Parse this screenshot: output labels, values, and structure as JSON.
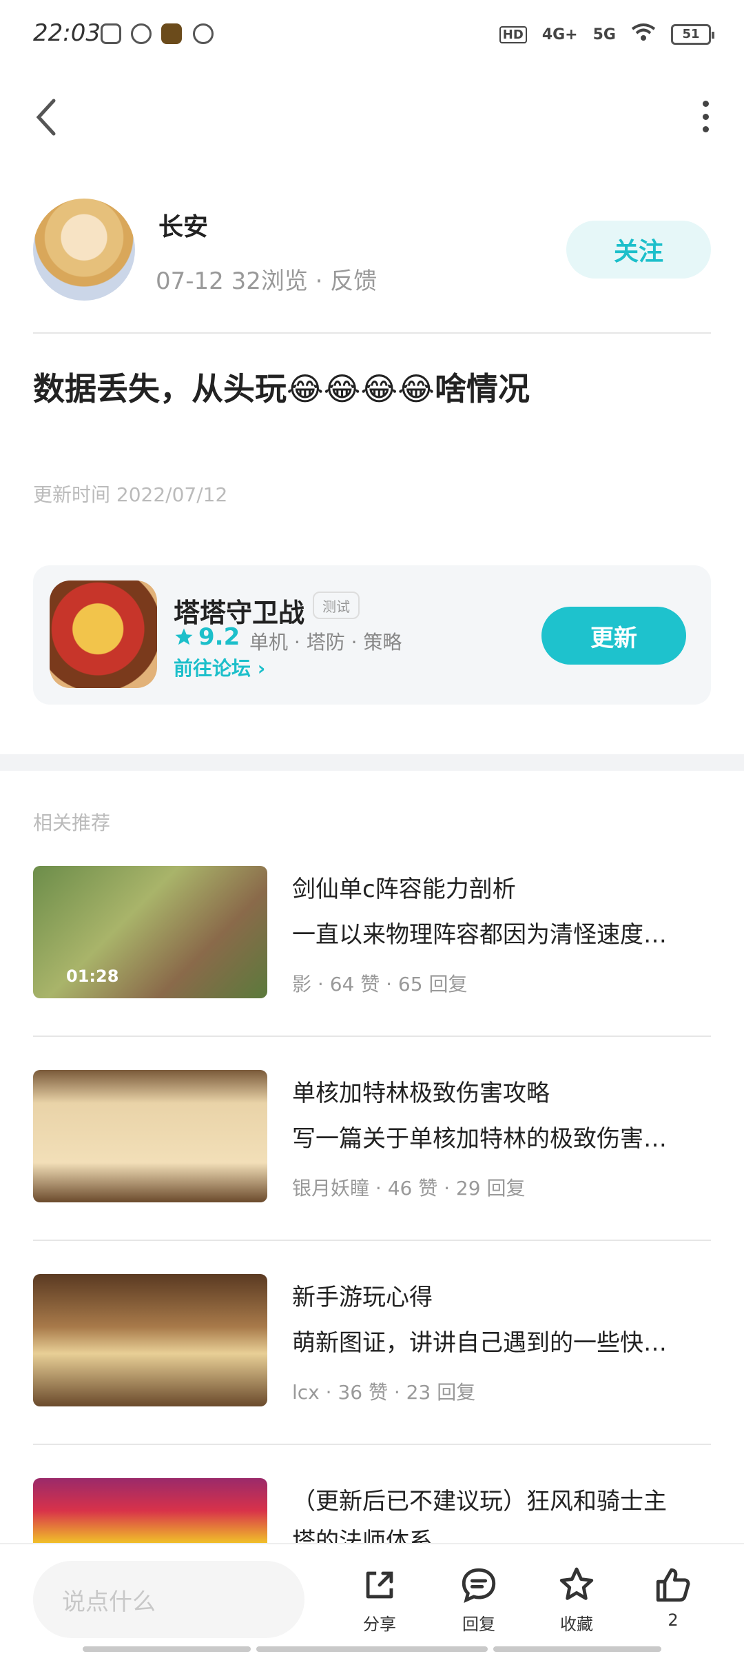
{
  "status_bar": {
    "time": "22:03",
    "network1": "4G+",
    "network2": "5G",
    "battery": "51"
  },
  "author": {
    "name": "长安",
    "meta": "07-12  32浏览 · 反馈",
    "follow_label": "关注"
  },
  "post": {
    "title": "数据丢失，从头玩😂😂😂😂啥情况",
    "update_time": "更新时间 2022/07/12"
  },
  "game": {
    "name": "塔塔守卫战",
    "badge": "测试",
    "rating": "9.2",
    "tags": "单机 · 塔防 · 策略",
    "forum_link": "前往论坛",
    "update_label": "更新"
  },
  "related": {
    "title": "相关推荐",
    "items": [
      {
        "line1": "剑仙单c阵容能力剖析",
        "line2": "一直以来物理阵容都因为清怪速度…",
        "meta": "影 · 64 赞 · 65 回复",
        "duration": "01:28"
      },
      {
        "line1": "单核加特林极致伤害攻略",
        "line2": "写一篇关于单核加特林的极致伤害…",
        "meta": "银月妖瞳 · 46 赞 · 29 回复",
        "duration": ""
      },
      {
        "line1": "新手游玩心得",
        "line2": "萌新图证，讲讲自己遇到的一些快…",
        "meta": "lcx · 36 赞 · 23 回复",
        "duration": ""
      },
      {
        "line1": "（更新后已不建议玩）狂风和骑士主",
        "line2": "塔的法师体系",
        "meta": "",
        "duration": ""
      }
    ]
  },
  "bottom_bar": {
    "input_placeholder": "说点什么",
    "share": "分享",
    "reply": "回复",
    "favorite": "收藏",
    "like_count": "2"
  },
  "colors": {
    "accent": "#1cbfca",
    "follow_bg": "#e6f7f8"
  }
}
